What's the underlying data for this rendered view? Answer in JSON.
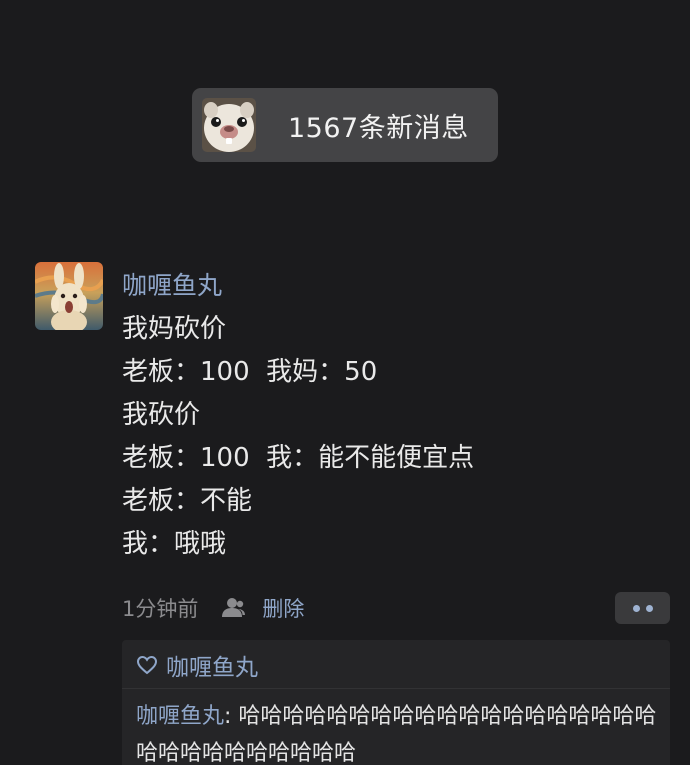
{
  "new_messages": {
    "text": "1567条新消息",
    "avatar_icon": "hamster-face-icon"
  },
  "post": {
    "author": "咖喱鱼丸",
    "avatar_icon": "scream-rabbit-avatar",
    "lines": [
      "我妈砍价",
      "老板：100  我妈：50",
      "我砍价",
      "老板：100  我：能不能便宜点",
      "老板：不能",
      "我：哦哦"
    ],
    "time": "1分钟前",
    "delete_label": "删除",
    "more_icon": "more-dots-icon"
  },
  "likes": {
    "icon": "heart-icon",
    "names": "咖喱鱼丸"
  },
  "comment": {
    "author": "咖喱鱼丸",
    "separator": ": ",
    "text": "哈哈哈哈哈哈哈哈哈哈哈哈哈哈哈哈哈哈哈哈哈哈哈哈哈哈哈哈哈"
  },
  "colors": {
    "background": "#1b1b1d",
    "link": "#8fa6c9",
    "pill": "#444446"
  }
}
